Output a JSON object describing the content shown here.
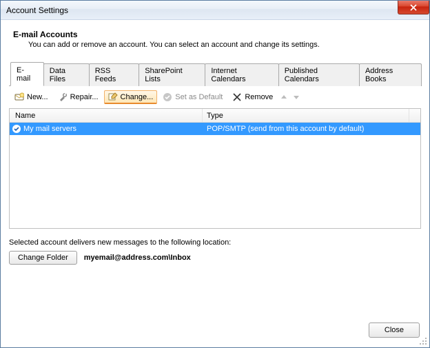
{
  "window": {
    "title": "Account Settings"
  },
  "header": {
    "title": "E-mail Accounts",
    "subtitle": "You can add or remove an account. You can select an account and change its settings."
  },
  "tabs": [
    {
      "label": "E-mail",
      "active": true
    },
    {
      "label": "Data Files"
    },
    {
      "label": "RSS Feeds"
    },
    {
      "label": "SharePoint Lists"
    },
    {
      "label": "Internet Calendars"
    },
    {
      "label": "Published Calendars"
    },
    {
      "label": "Address Books"
    }
  ],
  "toolbar": {
    "new": "New...",
    "repair": "Repair...",
    "change": "Change...",
    "set_default": "Set as Default",
    "remove": "Remove"
  },
  "list": {
    "columns": {
      "name": "Name",
      "type": "Type"
    },
    "rows": [
      {
        "name": "My mail servers",
        "type": "POP/SMTP (send from this account by default)",
        "selected": true,
        "default": true
      }
    ]
  },
  "location": {
    "text": "Selected account delivers new messages to the following location:",
    "change_folder": "Change Folder",
    "path": "myemail@address.com\\Inbox"
  },
  "footer": {
    "close": "Close"
  }
}
